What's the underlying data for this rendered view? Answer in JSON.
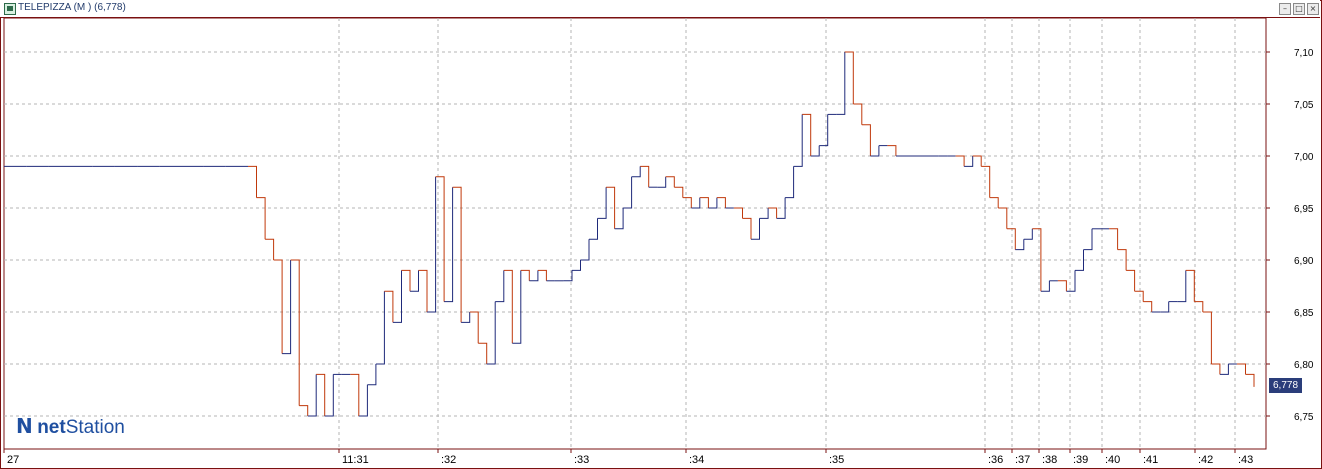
{
  "window": {
    "title": "TELEPIZZA (M ) (6,778)",
    "buttons": [
      "minimize",
      "restore",
      "close"
    ],
    "icon": "chart-window-icon"
  },
  "logo": {
    "mark": "N",
    "text_bold": "net",
    "text": "Station"
  },
  "last_value_label": "6,778",
  "colors": {
    "frame": "#7a1010",
    "grid": "#b5b5b5",
    "up_line": "#1f2a7a",
    "down_line": "#c0390b",
    "label_bg": "#2a3d7a"
  },
  "chart_data": {
    "type": "line",
    "title": "TELEPIZZA (M ) (6,778)",
    "xlabel": "",
    "ylabel": "",
    "ylim": [
      6.715,
      7.13
    ],
    "y_ticks": [
      "7,10",
      "7,05",
      "7,00",
      "6,95",
      "6,90",
      "6,85",
      "6,80",
      "6,75"
    ],
    "y_tick_values": [
      7.1,
      7.05,
      7.0,
      6.95,
      6.9,
      6.85,
      6.8,
      6.75
    ],
    "x_ticks": [
      "27",
      "11:31",
      ":32",
      ":33",
      ":34",
      ":35",
      ":36",
      ":37",
      ":38",
      ":39",
      ":40",
      ":41",
      ":42",
      ":43"
    ],
    "grid": true,
    "last_value": 6.778,
    "series": [
      {
        "values": [
          6.99,
          6.99,
          6.99,
          6.99,
          6.99,
          6.99,
          6.99,
          6.99,
          6.99,
          6.99,
          6.99,
          6.99,
          6.96,
          6.92,
          6.9,
          6.81,
          6.9,
          6.76,
          6.75,
          6.79,
          6.75,
          6.79,
          6.79,
          6.79,
          6.75,
          6.78,
          6.8,
          6.87,
          6.84,
          6.89,
          6.87,
          6.89,
          6.85,
          6.98,
          6.86,
          6.97,
          6.84,
          6.85,
          6.82,
          6.8,
          6.86,
          6.89,
          6.82,
          6.89,
          6.88,
          6.89,
          6.88,
          6.88,
          6.88,
          6.89,
          6.9,
          6.92,
          6.94,
          6.97,
          6.93,
          6.95,
          6.98,
          6.99,
          6.97,
          6.97,
          6.98,
          6.97,
          6.96,
          6.95,
          6.96,
          6.95,
          6.96,
          6.95,
          6.95,
          6.94,
          6.92,
          6.94,
          6.95,
          6.94,
          6.96,
          6.99,
          7.04,
          7.0,
          7.01,
          7.04,
          7.04,
          7.1,
          7.05,
          7.03,
          7.0,
          7.01,
          7.01,
          7.0,
          7.0,
          7.0,
          7.0,
          7.0,
          7.0,
          7.0,
          7.0,
          6.99,
          7.0,
          6.99,
          6.96,
          6.95,
          6.93,
          6.91,
          6.92,
          6.93,
          6.87,
          6.88,
          6.88,
          6.87,
          6.89,
          6.91,
          6.93,
          6.93,
          6.93,
          6.91,
          6.89,
          6.87,
          6.86,
          6.85,
          6.85,
          6.86,
          6.86,
          6.89,
          6.86,
          6.85,
          6.8,
          6.79,
          6.8,
          6.8,
          6.79,
          6.778
        ]
      }
    ]
  }
}
